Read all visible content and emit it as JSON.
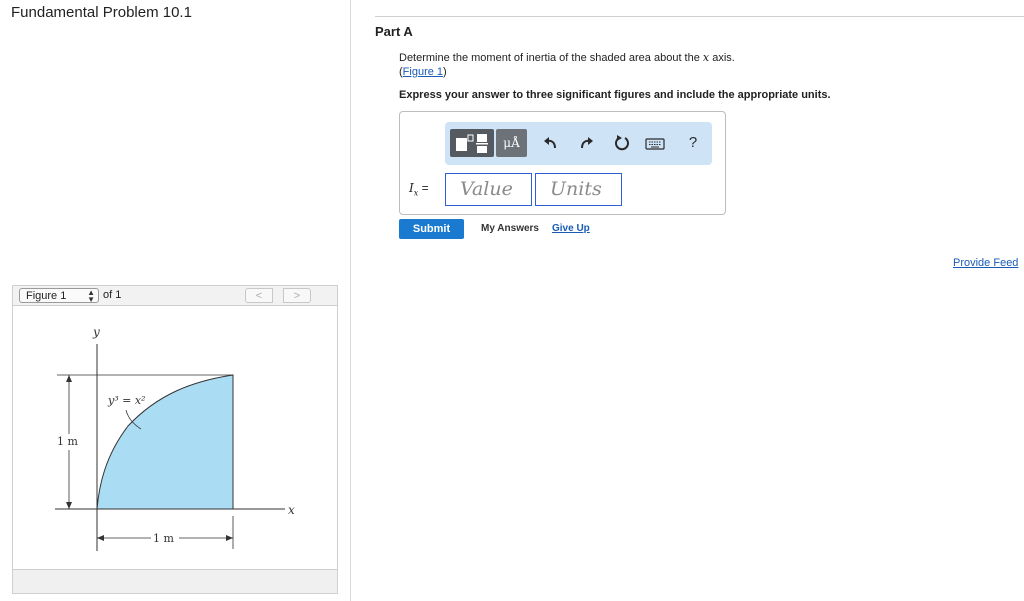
{
  "problem": {
    "title": "Fundamental Problem 10.1"
  },
  "figure_panel": {
    "select_label": "Figure 1",
    "of_text": "of 1",
    "prev_glyph": "<",
    "next_glyph": ">",
    "diagram": {
      "y_axis_label": "y",
      "x_axis_label": "x",
      "curve_equation": "y³ = x²",
      "height_dimension": "1 m",
      "width_dimension": "1 m",
      "fill_color": "#aadcf4"
    }
  },
  "part": {
    "label": "Part A",
    "question_prefix": "Determine the moment of inertia of the shaded area about the ",
    "question_var": "x",
    "question_suffix": " axis.",
    "figure_link_open": "(",
    "figure_link_text": "Figure 1",
    "figure_link_close": ")",
    "instruction": "Express your answer to three significant figures and include the appropriate units."
  },
  "answer": {
    "toolbar": {
      "units_label": "μÅ",
      "icons": [
        "templates-icon",
        "units-icon",
        "undo-icon",
        "redo-icon",
        "reset-icon",
        "keyboard-icon",
        "help-icon"
      ],
      "help_label": "?"
    },
    "variable_label": "I",
    "variable_sub": "x",
    "equals": "=",
    "value_placeholder": "Value",
    "units_placeholder": "Units"
  },
  "actions": {
    "submit": "Submit",
    "my_answers": "My Answers",
    "give_up": "Give Up"
  },
  "feedback": {
    "link": "Provide Feed"
  },
  "colors": {
    "accent": "#1a7ad0",
    "link": "#1a5bb6",
    "toolbar_bg": "#cfe3f7"
  }
}
